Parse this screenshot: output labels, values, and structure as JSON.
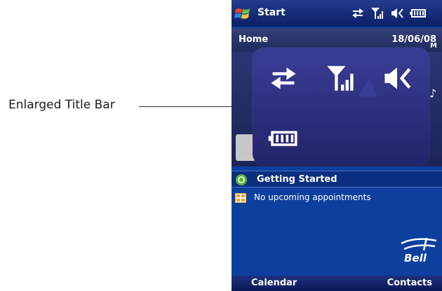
{
  "callout": {
    "label": "Enlarged Title Bar"
  },
  "titlebar": {
    "title": "Start"
  },
  "home": {
    "label": "Home",
    "date": "18/06/08"
  },
  "today": {
    "getting_started": "Getting Started",
    "appointments": "No upcoming appointments"
  },
  "softkeys": {
    "left": "Calendar",
    "right": "Contacts"
  },
  "brand": {
    "logo_text": "Bell"
  },
  "icons": {
    "status": [
      "sync-icon",
      "signal-icon",
      "volume-icon",
      "battery-icon"
    ],
    "popup": [
      "sync-icon",
      "signal-icon",
      "volume-icon",
      "battery-icon"
    ]
  },
  "colors": {
    "screen_bg": "#0d3f9e",
    "popup_bg": "#2f3180",
    "titlebar_bg": "#13287a"
  }
}
